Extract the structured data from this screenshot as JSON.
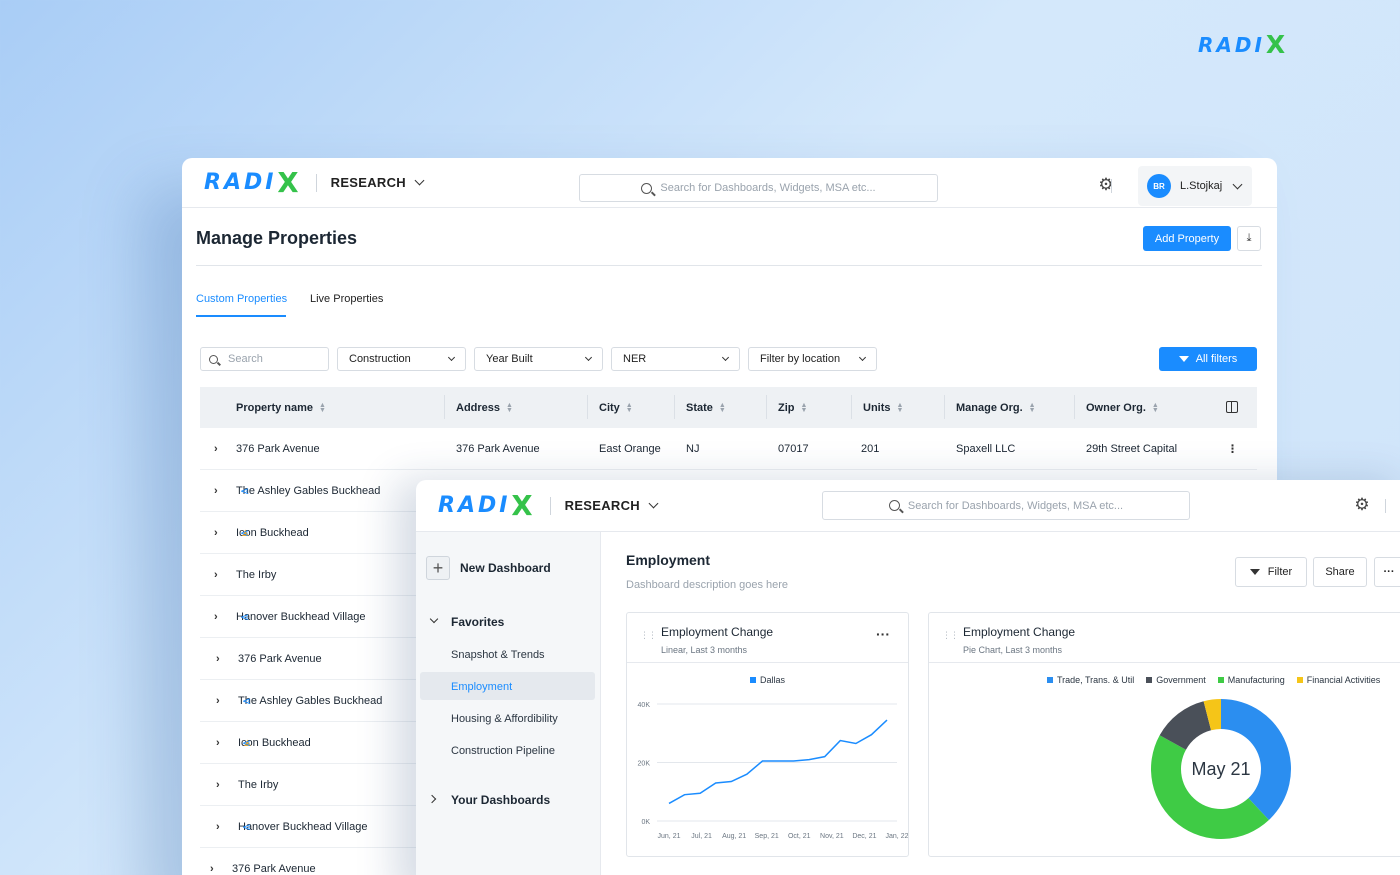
{
  "brand": {
    "logo_main": "RADI",
    "logo_x": "X",
    "accent": "#1a8cff",
    "accent2": "#35c24a"
  },
  "back": {
    "app_name": "RESEARCH",
    "search_placeholder": "Search for Dashboards, Widgets, MSA etc...",
    "user": {
      "initials": "BR",
      "name": "L.Stojkaj"
    },
    "page_title": "Manage Properties",
    "add_button": "Add Property",
    "tabs": [
      "Custom Properties",
      "Live Properties"
    ],
    "filters": {
      "search_placeholder": "Search",
      "construction": "Construction",
      "year_built": "Year Built",
      "ner": "NER",
      "location": "Filter by location",
      "all_filters": "All filters"
    },
    "columns": [
      "Property name",
      "Address",
      "City",
      "State",
      "Zip",
      "Units",
      "Manage Org.",
      "Owner Org."
    ],
    "rows": [
      {
        "name": "376 Park Avenue",
        "address": "376 Park Avenue",
        "city": "East Orange",
        "state": "NJ",
        "zip": "07017",
        "units": "201",
        "manage": "Spaxell LLC",
        "owner": "29th Street Capital"
      },
      {
        "name": "The Ashley Gables Buckhead"
      },
      {
        "name": "Icon Buckhead"
      },
      {
        "name": "The Irby"
      },
      {
        "name": "Hanover Buckhead Village"
      },
      {
        "name": "376 Park Avenue"
      },
      {
        "name": "The Ashley Gables Buckhead"
      },
      {
        "name": "Icon Buckhead"
      },
      {
        "name": "The Irby"
      },
      {
        "name": "Hanover Buckhead Village"
      },
      {
        "name": "376 Park Avenue"
      }
    ]
  },
  "front": {
    "app_name": "RESEARCH",
    "search_placeholder": "Search for Dashboards, Widgets, MSA etc...",
    "sidebar": {
      "new_dashboard": "New Dashboard",
      "favorites": "Favorites",
      "items": [
        "Snapshot & Trends",
        "Employment",
        "Housing & Affordibility",
        "Construction Pipeline"
      ],
      "your_dashboards": "Your Dashboards"
    },
    "dashboard": {
      "title": "Employment",
      "description": "Dashboard description goes here",
      "filter": "Filter",
      "share": "Share"
    },
    "cards": [
      {
        "title": "Employment Change",
        "subtitle": "Linear, Last 3 months"
      },
      {
        "title": "Employment Change",
        "subtitle": "Pie Chart, Last 3 months",
        "center_label": "May 21"
      }
    ]
  },
  "chart_data": [
    {
      "type": "line",
      "x": [
        "Jun, 21",
        "Jul, 21",
        "Aug, 21",
        "Sep, 21",
        "Oct, 21",
        "Nov, 21",
        "Dec, 21",
        "Jan, 22"
      ],
      "series": [
        {
          "name": "Dallas",
          "color": "#1a8cff",
          "values": [
            6,
            9,
            9.5,
            13,
            13.5,
            16,
            20.5,
            20.5,
            20.5,
            21,
            22,
            27.5,
            26.5,
            29.5,
            34.5
          ]
        }
      ],
      "ytick_labels": [
        "0K",
        "20K",
        "40K"
      ],
      "ylim": [
        0,
        40
      ],
      "grid": true,
      "legend": "top-center"
    },
    {
      "type": "pie",
      "series": [
        {
          "name": "Trade, Trans. & Util",
          "color": "#2b8ef0",
          "value": 38
        },
        {
          "name": "Manufacturing",
          "color": "#3fcb45",
          "value": 45
        },
        {
          "name": "Government",
          "color": "#4a5059",
          "value": 13
        },
        {
          "name": "Financial Activities",
          "color": "#f5c518",
          "value": 4
        }
      ],
      "legend_order": [
        "Trade, Trans. & Util",
        "Government",
        "Manufacturing",
        "Financial Activities"
      ],
      "legend": "top-right"
    }
  ]
}
